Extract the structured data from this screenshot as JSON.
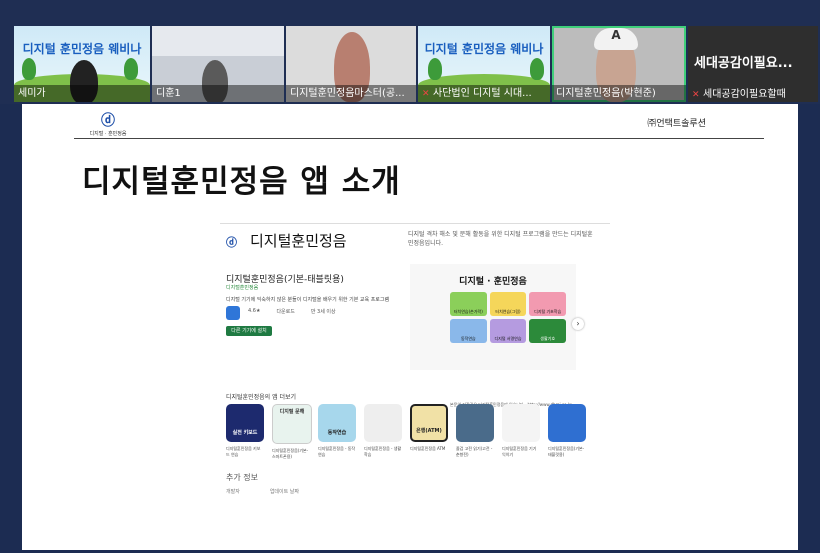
{
  "participants": [
    {
      "name": "세미가",
      "banner": "디지털 훈민정음 웨비나"
    },
    {
      "name": "디훈1"
    },
    {
      "name": "디지털훈민정음마스터(공..."
    },
    {
      "name": "사단법인 디지털 시대...",
      "banner": "디지털 훈민정음 웨비나"
    },
    {
      "name": "디지털훈민정음(박현준)"
    },
    {
      "name": "세대공감이필요할때",
      "display": "세대공감이필요..."
    }
  ],
  "slide": {
    "logo_caption": "디지털 · 훈민정음",
    "company": "㈜언택트솔루션",
    "title": "디지털훈민정음 앱 소개",
    "store": {
      "header": "디지털훈민정음",
      "description": "디지털 격차 해소 및 문해 활동을 위한 디지털 프로그램을 만드는 디지털훈민정음입니다.",
      "app_title": "디지털훈민정음(기본-태블릿용)",
      "developer": "디지털훈민정음",
      "subtitle": "디지털 기기에 익숙하지 않은 분들이 디지털을 배우기 위한 기본 교육 프로그램",
      "stats": [
        "4.6★",
        "다운로드",
        "만 3세 이상"
      ],
      "install": "다른 기기에 설치",
      "preview_title": "디지털 · 훈민정음",
      "preview_cells": [
        "터치연습(손가락)",
        "터치연습(그림)",
        "디지털 기초학습",
        "동작연습",
        "디지털 서명연습",
        "생활기호"
      ],
      "preview_footer": "본문의 저작권은 디지털훈민정음에 있습니다 · http://www.dhmj.co.kr",
      "section_head": "디지털훈민정음의 앱 더보기",
      "apps": [
        {
          "label": "실전 키보드",
          "caption": "디지털훈민정음 키보드 연습"
        },
        {
          "label": "디지털 문해",
          "caption": "디지털훈민정음(기본-스마트폰용)"
        },
        {
          "label": "동작연습",
          "caption": "디지털훈민정음 - 동작연습"
        },
        {
          "label": "",
          "caption": "디지털훈민정음 - 생활학습"
        },
        {
          "label": "은행(ATM)",
          "caption": "디지털훈민정음 ATM"
        },
        {
          "label": "",
          "caption": "즐겁 고전 읽기(고전 - 춘향전)"
        },
        {
          "label": "",
          "caption": "디지털훈민정음 기기익히기"
        },
        {
          "label": "",
          "caption": "디지털훈민정음(기본-태블릿용)"
        }
      ],
      "more_info": "추가 정보",
      "info": [
        "개발자",
        "업데이트 날짜"
      ]
    }
  },
  "colors": {
    "accent": "#1e4fa8",
    "install": "#1f7a42",
    "active_speaker": "#3fcf7a"
  }
}
